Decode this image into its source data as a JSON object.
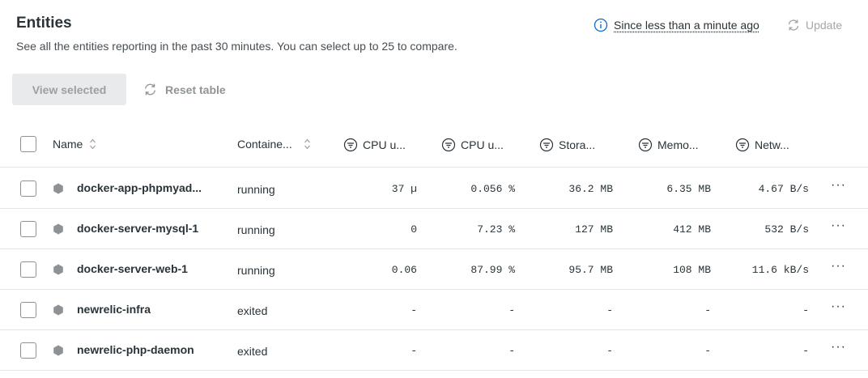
{
  "header": {
    "title": "Entities",
    "subtitle": "See all the entities reporting in the past 30 minutes. You can select up to 25 to compare.",
    "since": "Since less than a minute ago",
    "update": "Update"
  },
  "actions": {
    "view_selected": "View selected",
    "reset_table": "Reset table"
  },
  "table": {
    "columns": [
      "Name",
      "Containe...",
      "CPU u...",
      "CPU u...",
      "Stora...",
      "Memo...",
      "Netw..."
    ],
    "rows": [
      {
        "name": "docker-app-phpmyad...",
        "state": "running",
        "cpu1": "37 µ",
        "cpu2": "0.056 %",
        "storage": "36.2 MB",
        "memory": "6.35 MB",
        "network": "4.67 B/s"
      },
      {
        "name": "docker-server-mysql-1",
        "state": "running",
        "cpu1": "0",
        "cpu2": "7.23 %",
        "storage": "127 MB",
        "memory": "412 MB",
        "network": "532 B/s"
      },
      {
        "name": "docker-server-web-1",
        "state": "running",
        "cpu1": "0.06",
        "cpu2": "87.99 %",
        "storage": "95.7 MB",
        "memory": "108 MB",
        "network": "11.6 kB/s"
      },
      {
        "name": "newrelic-infra",
        "state": "exited",
        "cpu1": "-",
        "cpu2": "-",
        "storage": "-",
        "memory": "-",
        "network": "-"
      },
      {
        "name": "newrelic-php-daemon",
        "state": "exited",
        "cpu1": "-",
        "cpu2": "-",
        "storage": "-",
        "memory": "-",
        "network": "-"
      }
    ],
    "more": "···"
  },
  "colors": {
    "info": "#0b6acb",
    "entity": "#8e9294",
    "border": "#e3e4e4"
  },
  "icons": [
    "info-icon",
    "refresh-icon",
    "sort-icon",
    "filter-icon",
    "entity-hexagon-icon",
    "more-icon"
  ]
}
